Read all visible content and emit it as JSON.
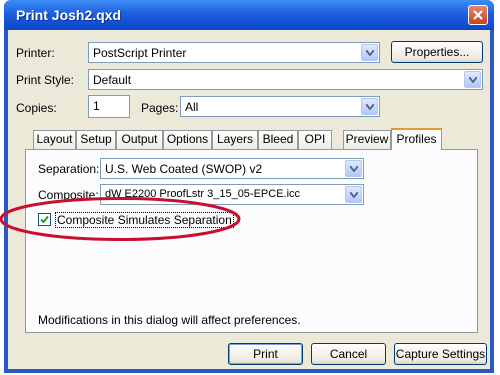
{
  "window": {
    "title": "Print Josh2.qxd"
  },
  "printer": {
    "label": "Printer:",
    "value": "PostScript Printer",
    "properties_button": "Properties..."
  },
  "print_style": {
    "label": "Print Style:",
    "value": "Default"
  },
  "copies": {
    "label": "Copies:",
    "value": "1"
  },
  "pages": {
    "label": "Pages:",
    "value": "All"
  },
  "tabs": [
    "Layout",
    "Setup",
    "Output",
    "Options",
    "Layers",
    "Bleed",
    "OPI",
    "Preview",
    "Profiles"
  ],
  "active_tab": "Profiles",
  "profiles": {
    "separation_label": "Separation:",
    "separation_value": "U.S. Web Coated (SWOP) v2",
    "composite_label": "Composite:",
    "composite_value": "dW E2200 ProofLstr 3_15_05-EPCE.icc",
    "checkbox_label": "Composite Simulates Separation",
    "checkbox_checked": true
  },
  "notice": "Modifications in this dialog will affect preferences.",
  "buttons": {
    "print": "Print",
    "cancel": "Cancel",
    "capture": "Capture Settings"
  },
  "colors": {
    "titlebar": "#1d5fe0",
    "dialog_bg": "#ece9d8",
    "annotation": "#c8102e",
    "active_tab_accent": "#e69a30"
  }
}
